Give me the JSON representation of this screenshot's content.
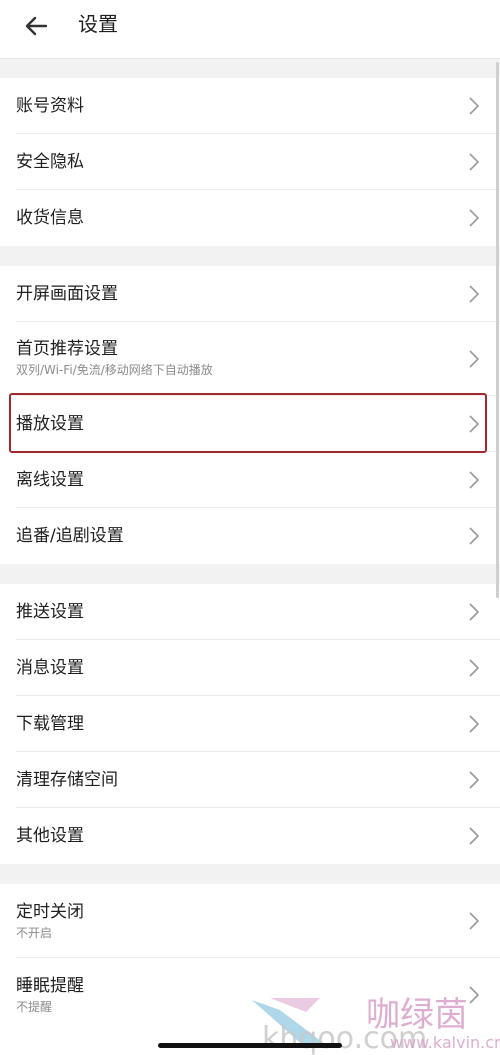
{
  "header": {
    "title": "设置",
    "back_icon": "arrow-left-icon"
  },
  "groups": [
    {
      "items": [
        {
          "label": "账号资料"
        },
        {
          "label": "安全隐私"
        },
        {
          "label": "收货信息"
        }
      ]
    },
    {
      "items": [
        {
          "label": "开屏画面设置"
        },
        {
          "label": "首页推荐设置",
          "sub": "双列/Wi-Fi/免流/移动网络下自动播放"
        },
        {
          "label": "播放设置",
          "highlighted": true
        },
        {
          "label": "离线设置"
        },
        {
          "label": "追番/追剧设置"
        }
      ]
    },
    {
      "items": [
        {
          "label": "推送设置"
        },
        {
          "label": "消息设置"
        },
        {
          "label": "下载管理"
        },
        {
          "label": "清理存储空间"
        },
        {
          "label": "其他设置"
        }
      ]
    },
    {
      "items": [
        {
          "label": "定时关闭",
          "sub": "不开启"
        },
        {
          "label": "睡眠提醒",
          "sub": "不提醒"
        }
      ]
    }
  ],
  "watermark": {
    "brand": "咖绿茵",
    "url": "www.kalvin.cn",
    "logo_text": "khqoo.com"
  },
  "colors": {
    "highlight_border": "#a3272e",
    "background": "#f2f2f2",
    "watermark_pink": "#d9a0c8",
    "watermark_blue": "#6bb7d8"
  }
}
